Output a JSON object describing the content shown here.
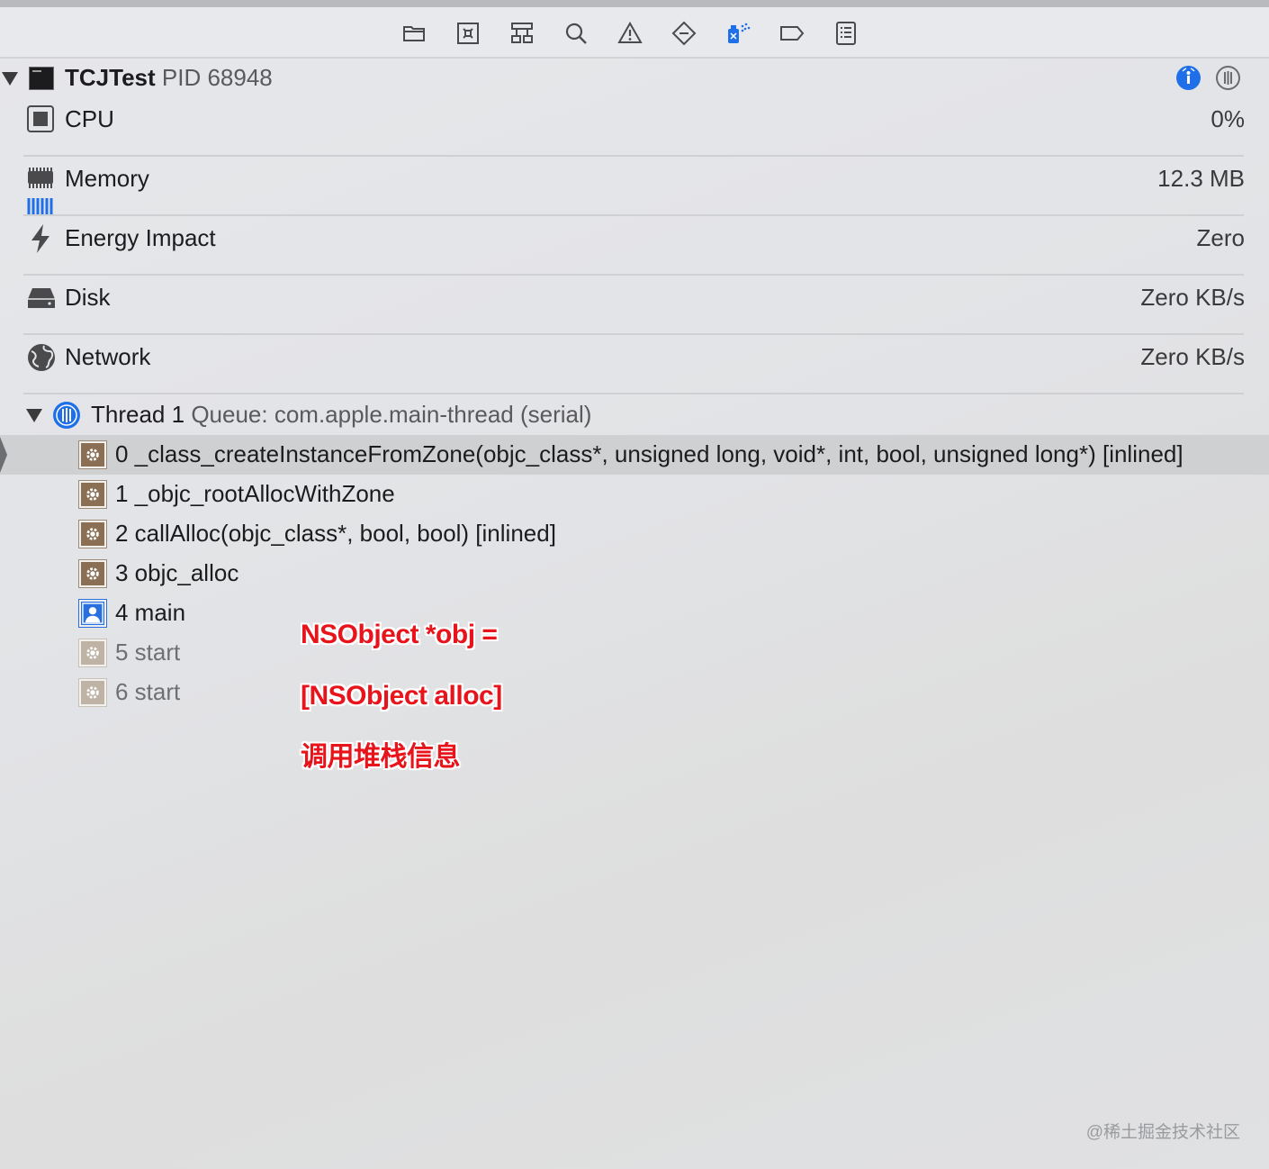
{
  "toolbar": {
    "icons": [
      "folder-icon",
      "source-control-icon",
      "hierarchy-icon",
      "search-icon",
      "warning-icon",
      "test-diamond-icon",
      "debug-spray-icon",
      "breakpoint-tag-icon",
      "report-icon"
    ],
    "active_icon": "debug-spray-icon",
    "accent_color": "#1f6fe8"
  },
  "process": {
    "name": "TCJTest",
    "pid_label": "PID 68948"
  },
  "gauges": [
    {
      "label": "CPU",
      "value": "0%",
      "icon": "cpu-chip-icon"
    },
    {
      "label": "Memory",
      "value": "12.3 MB",
      "icon": "memory-ram-icon"
    },
    {
      "label": "Energy Impact",
      "value": "Zero",
      "icon": "bolt-icon"
    },
    {
      "label": "Disk",
      "value": "Zero KB/s",
      "icon": "disk-drive-icon"
    },
    {
      "label": "Network",
      "value": "Zero KB/s",
      "icon": "globe-network-icon"
    }
  ],
  "thread": {
    "name": "Thread 1",
    "queue": "Queue: com.apple.main-thread (serial)"
  },
  "frames": [
    {
      "label": "0 _class_createInstanceFromZone(objc_class*, unsigned long, void*, int, bool, unsigned long*) [inlined]",
      "kind": "system"
    },
    {
      "label": "1 _objc_rootAllocWithZone",
      "kind": "system"
    },
    {
      "label": "2 callAlloc(objc_class*, bool, bool) [inlined]",
      "kind": "system"
    },
    {
      "label": "3 objc_alloc",
      "kind": "system"
    },
    {
      "label": "4 main",
      "kind": "user"
    },
    {
      "label": "5 start",
      "kind": "faded"
    },
    {
      "label": "6 start",
      "kind": "faded"
    }
  ],
  "annotation": {
    "line1": "NSObject  *obj =",
    "line2": "[NSObject alloc]",
    "line3": "调用堆栈信息",
    "color": "#e8141c"
  },
  "watermark": "@稀土掘金技术社区"
}
